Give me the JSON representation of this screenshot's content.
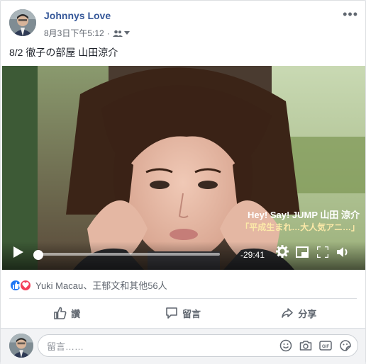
{
  "post": {
    "page_name": "Johnnys Love",
    "timestamp": "8月3日下午5:12",
    "audience_icon": "friends-icon",
    "text": "8/2 徹子の部屋 山田涼介"
  },
  "video": {
    "time_remaining": "-29:41",
    "progress": 0.01,
    "caption_line1": "Hey! Say! JUMP  山田 涼介",
    "caption_line2": "「平成生まれ…大人気アニ…」"
  },
  "reactions": {
    "icons": [
      "like-icon",
      "love-icon"
    ],
    "summary": "Yuki Macau、王郁文和其他56人"
  },
  "actions": {
    "like_label": "讚",
    "comment_label": "留言",
    "share_label": "分享"
  },
  "comment": {
    "placeholder": "留言……"
  },
  "colors": {
    "link": "#365899",
    "like_blue": "#2078f4",
    "love_red": "#f33e58"
  }
}
